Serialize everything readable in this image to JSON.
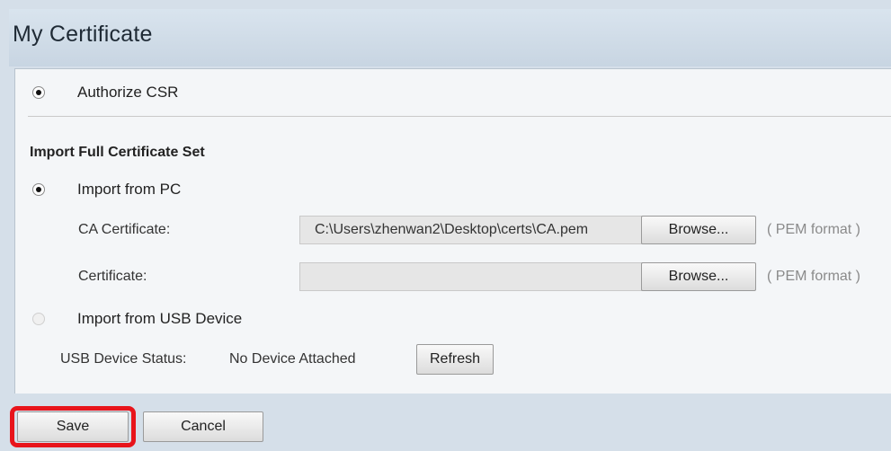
{
  "page": {
    "title": "My Certificate"
  },
  "authorize": {
    "label": "Authorize CSR"
  },
  "import_section": {
    "title": "Import Full Certificate Set",
    "from_pc_label": "Import from PC",
    "ca_cert": {
      "label": "CA Certificate:",
      "value": "C:\\Users\\zhenwan2\\Desktop\\certs\\CA.pem",
      "browse": "Browse...",
      "hint": "( PEM format )"
    },
    "cert": {
      "label": "Certificate:",
      "value": "",
      "browse": "Browse...",
      "hint": "( PEM format )"
    },
    "from_usb_label": "Import from USB Device",
    "usb_status_label": "USB Device Status:",
    "usb_status_value": "No Device Attached",
    "refresh": "Refresh"
  },
  "footer": {
    "save": "Save",
    "cancel": "Cancel"
  },
  "colors": {
    "highlight": "#e8141b",
    "background": "#d5dfe9",
    "panel": "#f4f6f8"
  }
}
